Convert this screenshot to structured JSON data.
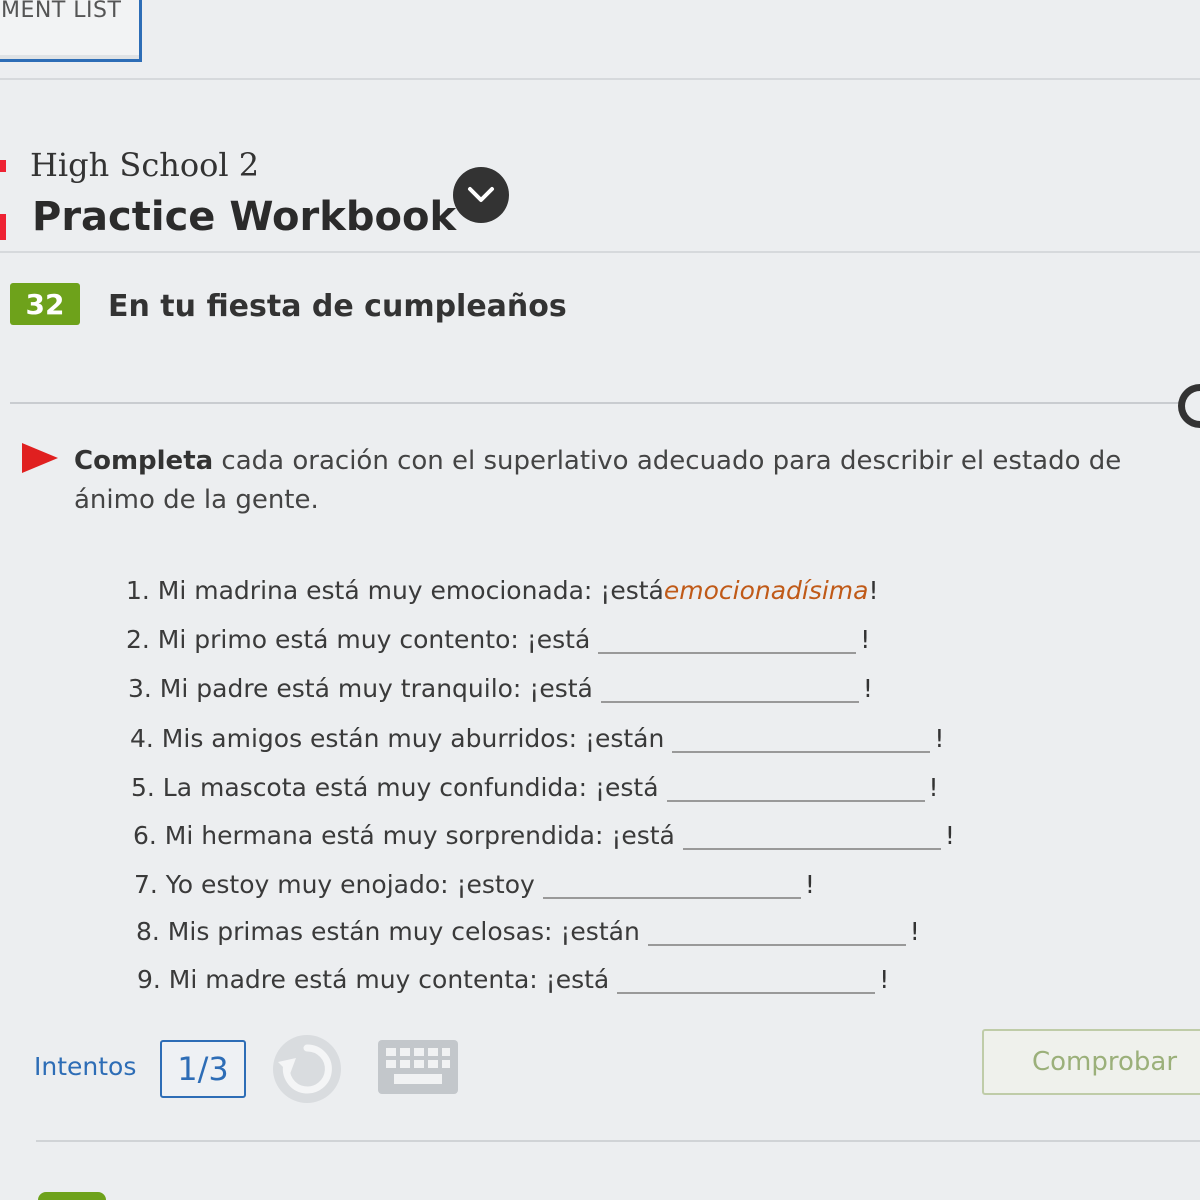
{
  "top_tab": {
    "label": "MENT LIST"
  },
  "book": {
    "subtitle": "High School 2",
    "title": "Practice Workbook",
    "toggle_icon": "chevron-down-icon"
  },
  "activity": {
    "number": "32",
    "title": "En tu fiesta de cumpleaños"
  },
  "instructions": {
    "verb": "Completa",
    "rest": " cada oración con el superlativo adecuado para describir el estado de ánimo de la gente."
  },
  "items": [
    {
      "prompt": "1. Mi madrina está muy emocionada: ¡está ",
      "answer": "emocionadísima",
      "end": "!"
    },
    {
      "prompt": "2. Mi primo está muy contento: ¡está",
      "answer": "",
      "end": "!"
    },
    {
      "prompt": "3. Mi padre está muy tranquilo: ¡está",
      "answer": "",
      "end": "!"
    },
    {
      "prompt": "4. Mis amigos están muy aburridos: ¡están",
      "answer": "",
      "end": "!"
    },
    {
      "prompt": "5. La mascota está muy confundida: ¡está",
      "answer": "",
      "end": "!"
    },
    {
      "prompt": "6. Mi hermana está muy sorprendida: ¡está",
      "answer": "",
      "end": "!"
    },
    {
      "prompt": "7. Yo estoy muy enojado: ¡estoy",
      "answer": "",
      "end": "!"
    },
    {
      "prompt": "8. Mis primas están muy celosas: ¡están",
      "answer": "",
      "end": "!"
    },
    {
      "prompt": "9. Mi madre está muy contenta: ¡está",
      "answer": "",
      "end": "!"
    }
  ],
  "footer": {
    "attempts_label": "Intentos",
    "attempts_value": "1/3",
    "reset_icon": "reset-icon",
    "keyboard_icon": "keyboard-icon",
    "check_label": "Comprobar"
  },
  "colors": {
    "accent_blue": "#2d6db6",
    "badge_green": "#6ea21b",
    "answer_orange": "#c05a18",
    "marker_red": "#e02020"
  }
}
